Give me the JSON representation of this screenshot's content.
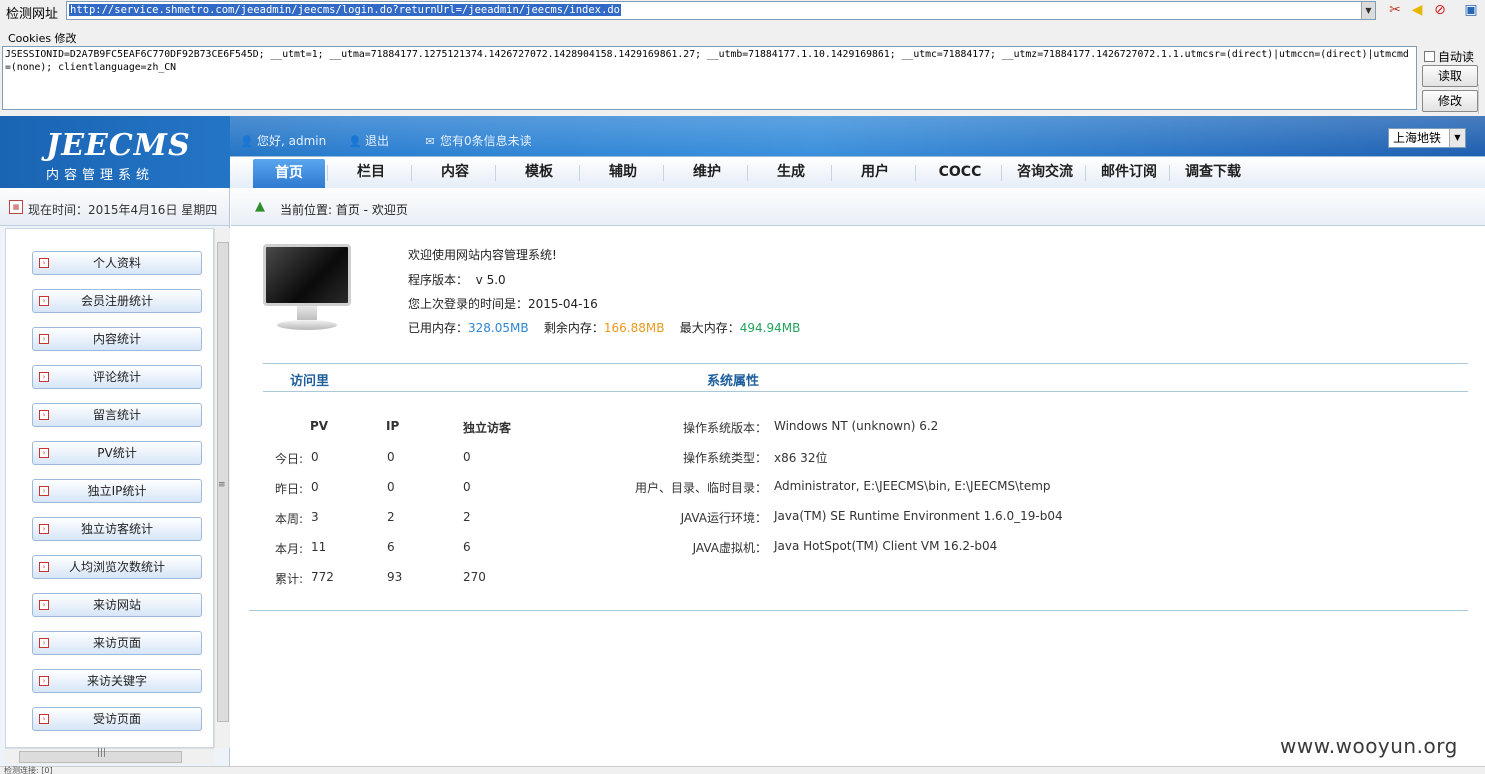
{
  "tool": {
    "url_label": "检测网址",
    "url_value": "http://service.shmetro.com/jeeadmin/jeecms/login.do?returnUrl=/jeeadmin/jeecms/index.do",
    "cookies_label": "Cookies 修改",
    "cookie_value": "JSESSIONID=D2A7B9FC5EAF6C770DF92B73CE6F545D; __utmt=1; __utma=71884177.1275121374.1426727072.1428904158.1429169861.27; __utmb=71884177.1.10.1429169861; __utmc=71884177; __utmz=71884177.1426727072.1.1.utmcsr=(direct)|utmccn=(direct)|utmcmd=(none); clientlanguage=zh_CN",
    "auto_read_label": "自动读",
    "read_button": "读取",
    "modify_button": "修改"
  },
  "header": {
    "logo_text": "JEECMS",
    "logo_sub": "内容管理系统",
    "greeting": "您好, admin",
    "logout": "退出",
    "messages": "您有0条信息未读",
    "site_select": "上海地铁"
  },
  "nav": {
    "items": [
      "首页",
      "栏目",
      "内容",
      "模板",
      "辅助",
      "维护",
      "生成",
      "用户",
      "COCC",
      "咨询交流",
      "邮件订阅",
      "调查下载"
    ],
    "active_index": 0
  },
  "sidebar": {
    "date_text": "现在时间：2015年4月16日  星期四",
    "menu": [
      "个人资料",
      "会员注册统计",
      "内容统计",
      "评论统计",
      "留言统计",
      "PV统计",
      "独立IP统计",
      "独立访客统计",
      "人均浏览次数统计",
      "来访网站",
      "来访页面",
      "来访关键字",
      "受访页面"
    ]
  },
  "main": {
    "breadcrumb": "当前位置: 首页 - 欢迎页",
    "welcome": "欢迎使用网站内容管理系统!",
    "version_label": "程序版本：",
    "version_value": "v 5.0",
    "last_login_label": "您上次登录的时间是：",
    "last_login_value": "2015-04-16",
    "mem_used_label": "已用内存：",
    "mem_used_value": "328.05MB",
    "mem_free_label": "剩余内存：",
    "mem_free_value": "166.88MB",
    "mem_max_label": "最大内存：",
    "mem_max_value": "494.94MB",
    "visits_title": "访问里",
    "system_title": "系统属性",
    "visits_headers": [
      "PV",
      "IP",
      "独立访客"
    ],
    "visits_rows": [
      {
        "label": "今日:",
        "pv": "0",
        "ip": "0",
        "uv": "0"
      },
      {
        "label": "昨日:",
        "pv": "0",
        "ip": "0",
        "uv": "0"
      },
      {
        "label": "本周:",
        "pv": "3",
        "ip": "2",
        "uv": "2"
      },
      {
        "label": "本月:",
        "pv": "11",
        "ip": "6",
        "uv": "6"
      },
      {
        "label": "累计:",
        "pv": "772",
        "ip": "93",
        "uv": "270"
      }
    ],
    "system_rows": [
      {
        "key": "操作系统版本：",
        "value": "Windows NT (unknown) 6.2"
      },
      {
        "key": "操作系统类型：",
        "value": "x86 32位"
      },
      {
        "key": "用户、目录、临时目录：",
        "value": "Administrator, E:\\JEECMS\\bin, E:\\JEECMS\\temp"
      },
      {
        "key": "JAVA运行环境：",
        "value": "Java(TM) SE Runtime Environment 1.6.0_19-b04"
      },
      {
        "key": "JAVA虚拟机：",
        "value": "Java HotSpot(TM) Client VM 16.2-b04"
      }
    ]
  },
  "status": {
    "text": "检测连接: [0]"
  },
  "watermark": "www.wooyun.org",
  "colors": {
    "header_blue": "#2b7fd1",
    "section_title": "#1e5f9c",
    "mem_used": "#2e86d1",
    "mem_free": "#e89a1e",
    "mem_max": "#23a35a"
  }
}
